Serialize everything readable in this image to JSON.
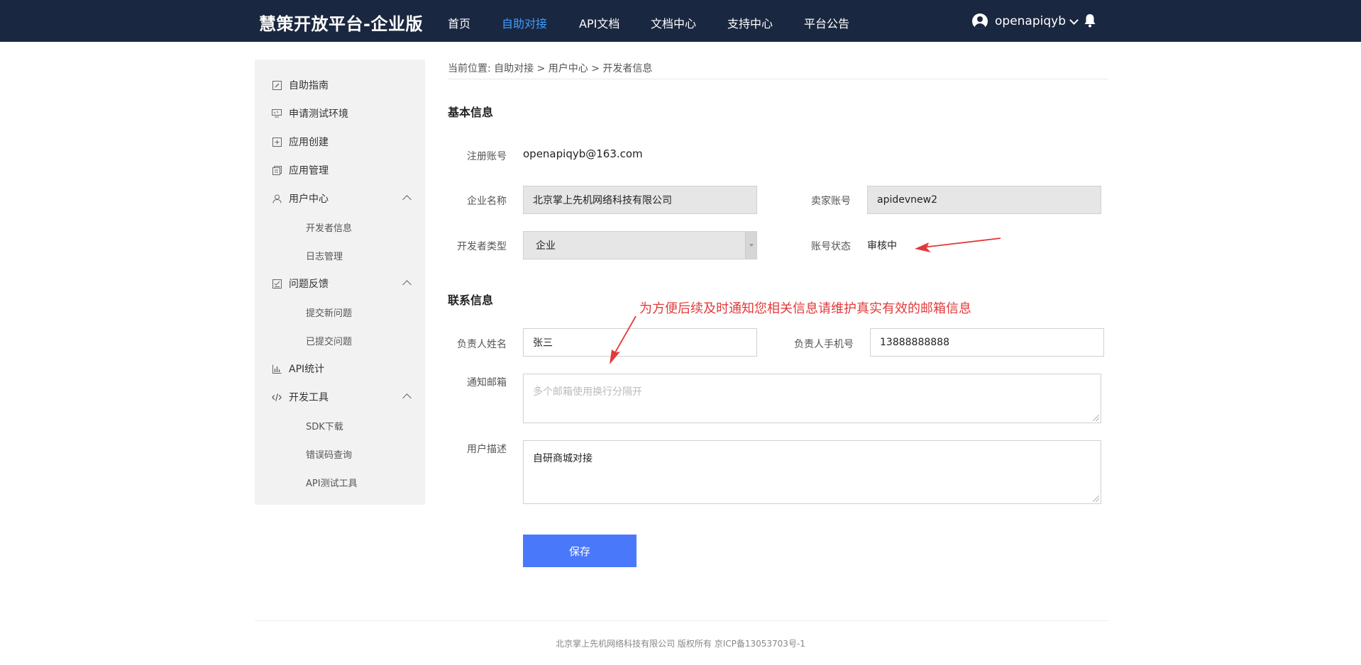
{
  "header": {
    "brand": "慧策开放平台-企业版",
    "nav": [
      "首页",
      "自助对接",
      "API文档",
      "文档中心",
      "支持中心",
      "平台公告"
    ],
    "active_nav": "自助对接",
    "username": "openapiqyb"
  },
  "sidebar": {
    "items": [
      {
        "label": "自助指南",
        "icon": "edit-icon"
      },
      {
        "label": "申请测试环境",
        "icon": "monitor-icon"
      },
      {
        "label": "应用创建",
        "icon": "add-box-icon"
      },
      {
        "label": "应用管理",
        "icon": "stack-icon"
      },
      {
        "label": "用户中心",
        "icon": "user-icon",
        "children": [
          "开发者信息",
          "日志管理"
        ]
      },
      {
        "label": "问题反馈",
        "icon": "checklist-icon",
        "children": [
          "提交新问题",
          "已提交问题"
        ]
      },
      {
        "label": "API统计",
        "icon": "bar-chart-icon"
      },
      {
        "label": "开发工具",
        "icon": "code-icon",
        "children": [
          "SDK下载",
          "错误码查询",
          "API测试工具"
        ]
      }
    ]
  },
  "breadcrumb": "当前位置:  自助对接 > 用户中心 > 开发者信息",
  "basic": {
    "title": "基本信息",
    "account_label": "注册账号",
    "account_value": "openapiqyb@163.com",
    "company_label": "企业名称",
    "company_value": "北京掌上先机网络科技有限公司",
    "seller_label": "卖家账号",
    "seller_value": "apidevnew2",
    "devtype_label": "开发者类型",
    "devtype_value": "企业",
    "status_label": "账号状态",
    "status_value": "审核中"
  },
  "contact": {
    "title": "联系信息",
    "name_label": "负责人姓名",
    "name_value": "张三",
    "phone_label": "负责人手机号",
    "phone_value": "13888888888",
    "email_label": "通知邮箱",
    "email_placeholder": "多个邮箱使用换行分隔开",
    "desc_label": "用户描述",
    "desc_value": "自研商城对接"
  },
  "save_label": "保存",
  "annotation": "为方便后续及时通知您相关信息请维护真实有效的邮箱信息",
  "annotation_color": "#e23a3a",
  "footer": "北京掌上先机网络科技有限公司 版权所有 京ICP备13053703号-1"
}
